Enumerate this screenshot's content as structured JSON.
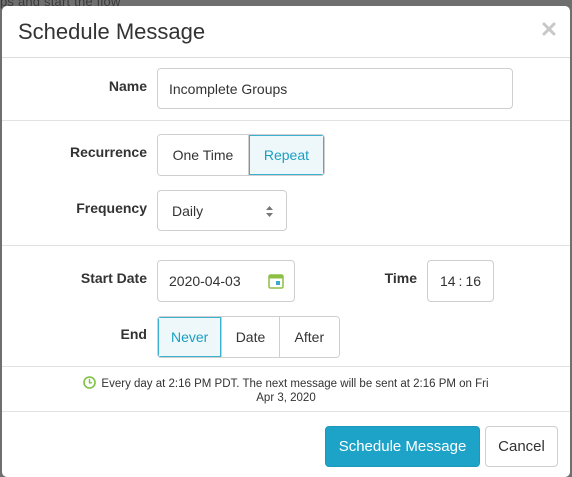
{
  "backdrop": {
    "text": "ps and start the flow"
  },
  "modal": {
    "title": "Schedule Message",
    "close_icon": "close-icon"
  },
  "form": {
    "name": {
      "label": "Name",
      "value": "Incomplete Groups"
    },
    "recurrence": {
      "label": "Recurrence",
      "options": [
        "One Time",
        "Repeat"
      ],
      "selected": "Repeat"
    },
    "frequency": {
      "label": "Frequency",
      "value": "Daily"
    },
    "start_date": {
      "label": "Start Date",
      "value": "2020-04-03",
      "icon": "calendar-icon"
    },
    "time": {
      "label": "Time",
      "hour": "14",
      "separator": ":",
      "minute": "16"
    },
    "end": {
      "label": "End",
      "options": [
        "Never",
        "Date",
        "After"
      ],
      "selected": "Never"
    }
  },
  "summary": {
    "icon": "clock-icon",
    "line1": "Every day at 2:16 PM PDT. The next message will be sent at 2:16 PM on Fri",
    "line2": "Apr 3, 2020"
  },
  "footer": {
    "primary_label": "Schedule Message",
    "secondary_label": "Cancel"
  },
  "colors": {
    "accent": "#1ea3c8",
    "active_bg": "#eef8fb",
    "clock_green": "#7cc242",
    "backdrop": "#6f6f6f"
  }
}
